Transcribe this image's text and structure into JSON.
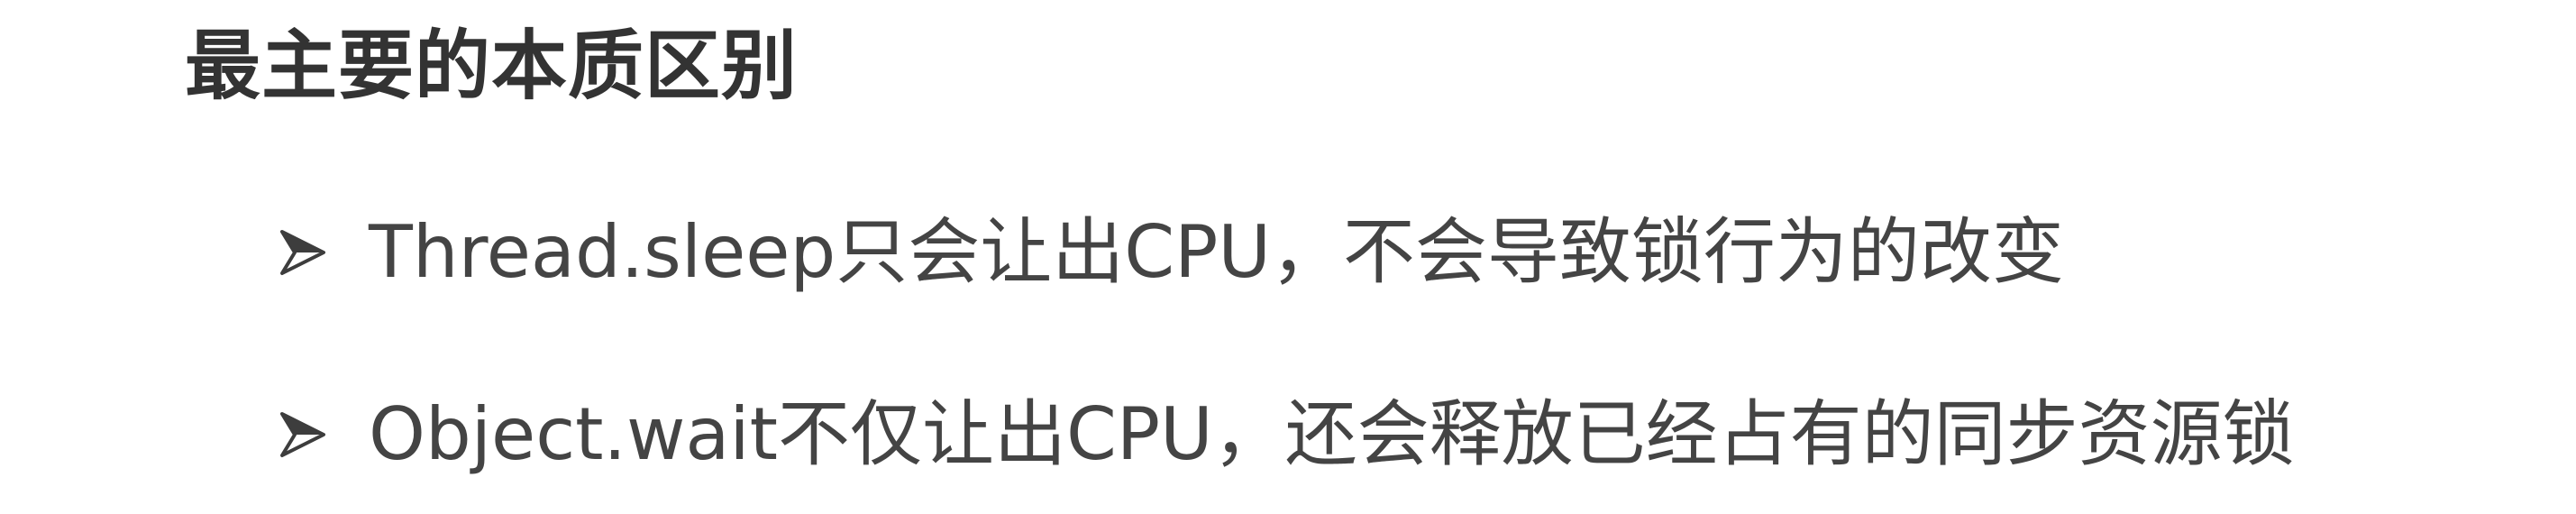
{
  "title": "最主要的本质区别",
  "bullets": [
    {
      "icon": "arrowhead-bullet-icon",
      "text": "Thread.sleep只会让出CPU，不会导致锁行为的改变"
    },
    {
      "icon": "arrowhead-bullet-icon",
      "text": "Object.wait不仅让出CPU，还会释放已经占有的同步资源锁"
    }
  ],
  "colors": {
    "background": "#ffffff",
    "title": "#333333",
    "text": "#444444",
    "bullet": "#3d3d3d"
  }
}
